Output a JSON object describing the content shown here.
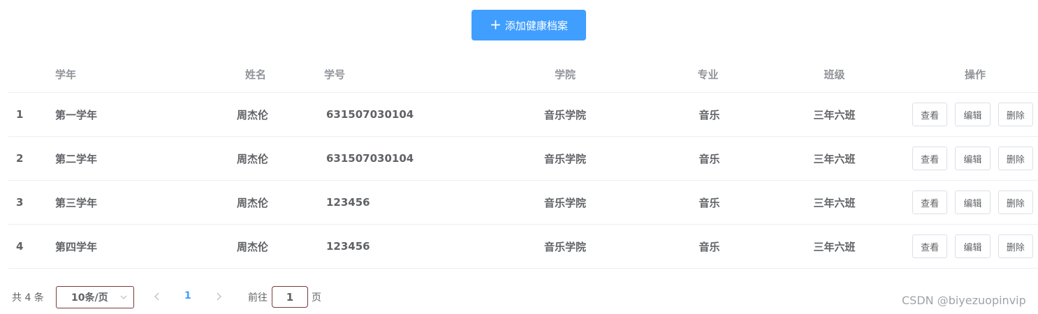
{
  "toolbar": {
    "add_label": "添加健康档案"
  },
  "table": {
    "headers": {
      "index": "",
      "year": "学年",
      "name": "姓名",
      "student_id": "学号",
      "college": "学院",
      "major": "专业",
      "class": "班级",
      "actions": "操作"
    },
    "rows": [
      {
        "index": "1",
        "year": "第一学年",
        "name": "周杰伦",
        "student_id": "631507030104",
        "college": "音乐学院",
        "major": "音乐",
        "class": "三年六班"
      },
      {
        "index": "2",
        "year": "第二学年",
        "name": "周杰伦",
        "student_id": "631507030104",
        "college": "音乐学院",
        "major": "音乐",
        "class": "三年六班"
      },
      {
        "index": "3",
        "year": "第三学年",
        "name": "周杰伦",
        "student_id": "123456",
        "college": "音乐学院",
        "major": "音乐",
        "class": "三年六班"
      },
      {
        "index": "4",
        "year": "第四学年",
        "name": "周杰伦",
        "student_id": "123456",
        "college": "音乐学院",
        "major": "音乐",
        "class": "三年六班"
      }
    ],
    "actions": {
      "view": "查看",
      "edit": "编辑",
      "delete": "删除"
    }
  },
  "pagination": {
    "total": "共 4 条",
    "page_size": "10条/页",
    "current_page": "1",
    "goto_label": "前往",
    "goto_value": "1",
    "page_unit": "页"
  },
  "watermark": "CSDN @biyezuopinvip",
  "colors": {
    "primary": "#409eff",
    "border": "#dcdfe6",
    "header_text": "#909399",
    "body_text": "#606266"
  }
}
